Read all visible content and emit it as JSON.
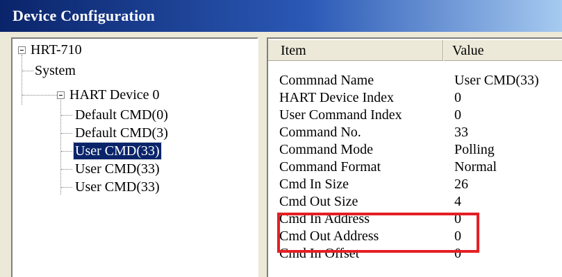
{
  "window": {
    "title": "Device Configuration"
  },
  "tree": {
    "root": "HRT-710",
    "system": "System",
    "device": "HART Device 0",
    "children": [
      "Default CMD(0)",
      "Default CMD(3)",
      "User CMD(33)",
      "User CMD(33)",
      "User CMD(33)"
    ],
    "selected_index": 2
  },
  "list": {
    "headers": {
      "item": "Item",
      "value": "Value"
    },
    "rows": [
      {
        "name": "Commnad Name",
        "value": "User CMD(33)"
      },
      {
        "name": "HART Device Index",
        "value": "0"
      },
      {
        "name": "User Command Index",
        "value": "0"
      },
      {
        "name": "Command No.",
        "value": "33"
      },
      {
        "name": "Command Mode",
        "value": "Polling"
      },
      {
        "name": "Command Format",
        "value": "Normal"
      },
      {
        "name": "Cmd In Size",
        "value": "26"
      },
      {
        "name": "Cmd Out Size",
        "value": "4"
      },
      {
        "name": "Cmd In Address",
        "value": "0"
      },
      {
        "name": "Cmd Out Address",
        "value": "0"
      },
      {
        "name": "Cmd In Offset",
        "value": "0"
      }
    ]
  },
  "highlight": {
    "color": "#e41f24"
  }
}
